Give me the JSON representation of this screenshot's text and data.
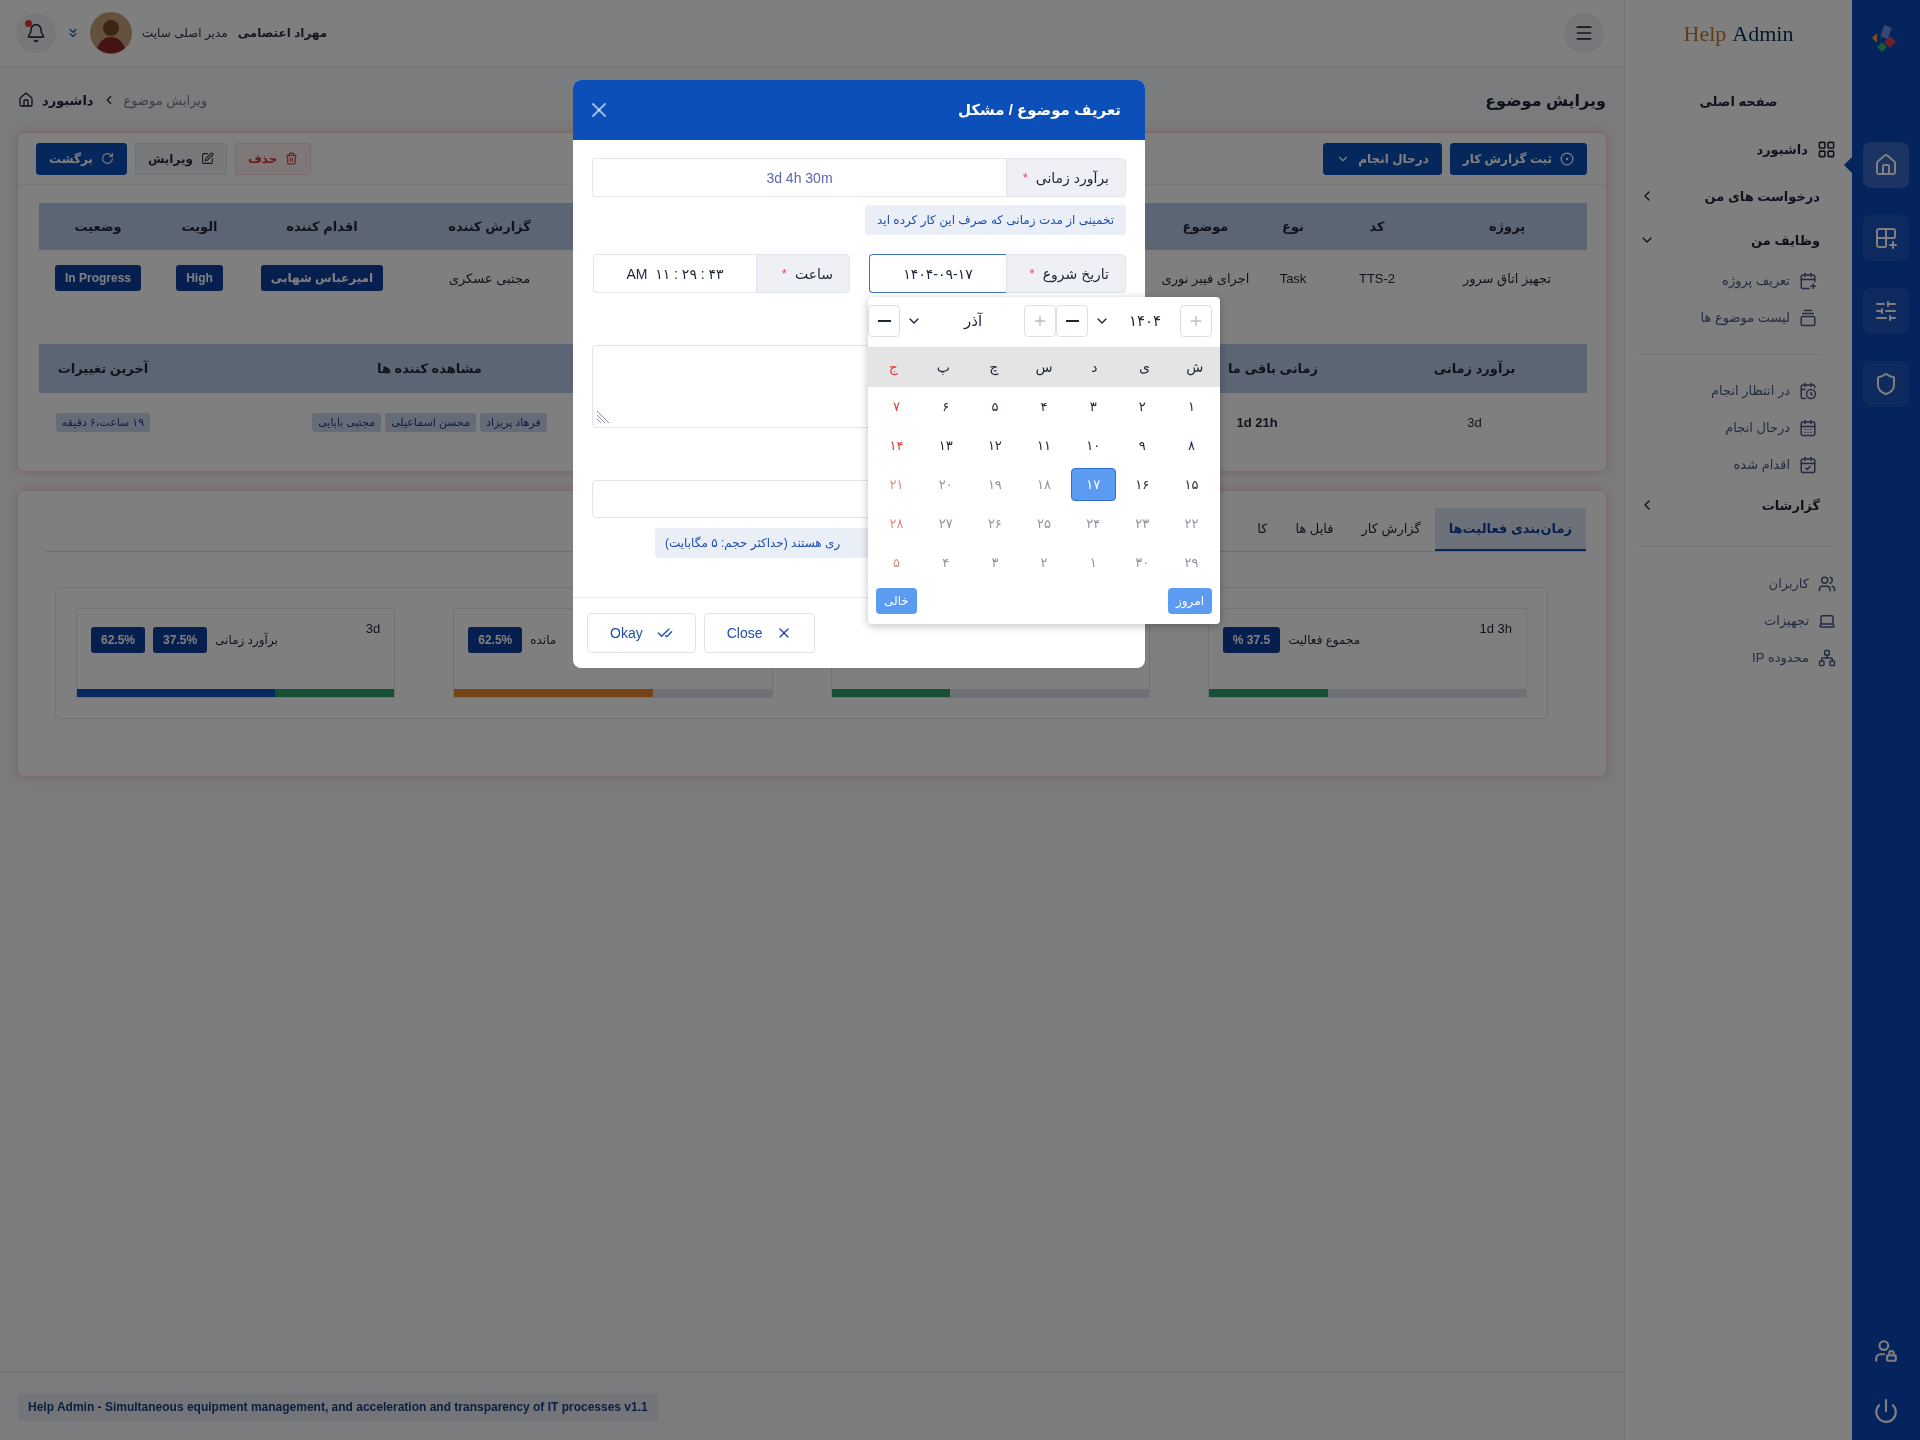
{
  "topbar": {
    "has_notification": true,
    "user_role": "مدیر اصلی سایت",
    "user_name": "مهراد اعتصامی"
  },
  "breadcrumb": [
    "ویرایش موضوع",
    "داشبورد"
  ],
  "page_title": "ویرایش موضوع",
  "actions": [
    {
      "label": "ثبت گزارش کار",
      "kind": "primary"
    },
    {
      "label": "درحال انجام",
      "kind": "dropdown"
    }
  ],
  "secondary_actions": [
    {
      "label": "حذف",
      "kind": "danger"
    },
    {
      "label": "ویرایش",
      "kind": "light"
    },
    {
      "label": "برگشت",
      "kind": "primary"
    }
  ],
  "issue_table": {
    "columns": [
      "پروژه",
      "کد",
      "نوع",
      "موضوع",
      "گزارش کننده",
      "اقدام کننده",
      "الویت",
      "وضعیت"
    ],
    "row": [
      {
        "kind": "text",
        "text": "تجهیز اتاق سرور"
      },
      {
        "kind": "text",
        "text": "TTS-2"
      },
      {
        "kind": "text",
        "text": "Task"
      },
      {
        "kind": "text",
        "text": "اجرای فیبر نوری"
      },
      {
        "kind": "text",
        "text": "مجتبی عسکری"
      },
      {
        "kind": "badge",
        "text": "امیرعباس شهابی"
      },
      {
        "kind": "badge",
        "text": "High"
      },
      {
        "kind": "badge",
        "text": "In Progress"
      }
    ]
  },
  "time_table": {
    "columns": [
      "برآورد زمانی",
      "زمانی باقی ما",
      "مشاهده کننده ها",
      "آخرین تغییرات"
    ],
    "row": [
      {
        "kind": "text",
        "text": "3d"
      },
      {
        "kind": "strong",
        "text": "1d 21h"
      },
      {
        "kind": "tags",
        "tags": [
          "فرهاد پریزاد",
          "محسن اسماعیلی",
          "مجتبی بابایی"
        ]
      },
      {
        "kind": "tags",
        "tags": [
          "۱۹ ساعت،۶ دقیقه"
        ]
      }
    ]
  },
  "tabs": [
    {
      "label": "زمان‌بندی فعالیت‌ها",
      "selected": true
    },
    {
      "label": "گزارش کار",
      "selected": false
    },
    {
      "label": "فایل ها",
      "selected": false
    },
    {
      "label": "کا",
      "selected": false
    }
  ],
  "stats": [
    {
      "value": "1d 3h",
      "label": "مجموع فعالیت",
      "badges": [
        "37.5 %"
      ],
      "segments": [
        {
          "level": 0.375,
          "color": "#174f35"
        }
      ]
    },
    {
      "segments": [
        {
          "level": 0.375,
          "color": "#174f35"
        }
      ]
    },
    {
      "label": "مانده",
      "badges": [
        "62.5%"
      ],
      "segments": [
        {
          "level": 0.625,
          "color": "#744416"
        }
      ]
    },
    {
      "value": "3d",
      "label": "برآورد زمانی",
      "badges": [
        "37.5%",
        "62.5%"
      ],
      "segments": [
        {
          "level": 0.625,
          "color": "#0a2860"
        },
        {
          "level": 0.375,
          "color": "#174f35"
        }
      ]
    }
  ],
  "footer": "Help Admin - Simultaneous equipment management, and acceleration and transparency of IT processes v1.1",
  "sidebar": {
    "logo": {
      "first": "Help",
      "second": "Admin"
    },
    "sections": [
      [
        {
          "kind": "heading",
          "label": "صفحه اصلی"
        },
        {
          "kind": "main",
          "label": "داشبورد"
        },
        {
          "kind": "group",
          "label": "درخواست های من",
          "expanded": false
        },
        {
          "kind": "group",
          "label": "وظایف من",
          "expanded": true,
          "children": [
            {
              "kind": "link",
              "label": "تعریف پروژه"
            },
            {
              "kind": "link",
              "label": "لیست موضوع ها"
            },
            {
              "kind": "divider"
            },
            {
              "kind": "link",
              "label": "در انتظار انجام"
            },
            {
              "kind": "link",
              "label": "درحال انجام"
            },
            {
              "kind": "link",
              "label": "اقدام شده"
            }
          ]
        },
        {
          "kind": "group",
          "label": "گزارشات",
          "expanded": false
        }
      ],
      [
        {
          "kind": "link",
          "label": "کاربران"
        },
        {
          "kind": "link",
          "label": "تجهیزات"
        },
        {
          "kind": "link",
          "label": "محدوده IP"
        }
      ]
    ]
  },
  "rail": {
    "items": [
      {
        "selected": true
      },
      {
        "selected": false
      },
      {
        "selected": false
      },
      {
        "selected": false
      }
    ]
  },
  "modal": {
    "title": "تعریف موضوع / مشکل",
    "estimate": {
      "label": "برآورد زمانی",
      "mark": "*",
      "value": "3d 4h 30m",
      "hint": "تخمینی از مدت زمانی که صرف این کار کرده اید"
    },
    "start_date": {
      "label": "تاریخ شروع",
      "mark": "*",
      "value": "۱۴۰۴-۰۹-۱۷",
      "focused": true
    },
    "time": {
      "label": "ساعت",
      "mark": "*",
      "value": "AM  ۱۱ : ۲۹ : ۴۳"
    },
    "upload_hint": "ری هستند (حداکثر حجم: ۵ مگابایت)",
    "buttons": [
      {
        "label": "Close",
        "kind": "close"
      },
      {
        "label": "Okay",
        "kind": "ok"
      }
    ]
  },
  "calendar": {
    "year": {
      "value": "۱۴۰۴",
      "increment_disabled": true
    },
    "month": {
      "value": "آذر",
      "increment_disabled": true
    },
    "weekdays": [
      {
        "label": "ش",
        "holiday": false
      },
      {
        "label": "ی",
        "holiday": false
      },
      {
        "label": "د",
        "holiday": false
      },
      {
        "label": "س",
        "holiday": false
      },
      {
        "label": "چ",
        "holiday": false
      },
      {
        "label": "پ",
        "holiday": false
      },
      {
        "label": "ج",
        "holiday": true
      }
    ],
    "days": [
      {
        "label": "۱",
        "selected": false,
        "disabled": false,
        "holiday": false
      },
      {
        "label": "۲",
        "selected": false,
        "disabled": false,
        "holiday": false
      },
      {
        "label": "۳",
        "selected": false,
        "disabled": false,
        "holiday": false
      },
      {
        "label": "۴",
        "selected": false,
        "disabled": false,
        "holiday": false
      },
      {
        "label": "۵",
        "selected": false,
        "disabled": false,
        "holiday": false
      },
      {
        "label": "۶",
        "selected": false,
        "disabled": false,
        "holiday": false
      },
      {
        "label": "۷",
        "selected": false,
        "disabled": false,
        "holiday": true
      },
      {
        "label": "۸",
        "selected": false,
        "disabled": false,
        "holiday": false
      },
      {
        "label": "۹",
        "selected": false,
        "disabled": false,
        "holiday": false
      },
      {
        "label": "۱۰",
        "selected": false,
        "disabled": false,
        "holiday": false
      },
      {
        "label": "۱۱",
        "selected": false,
        "disabled": false,
        "holiday": false
      },
      {
        "label": "۱۲",
        "selected": false,
        "disabled": false,
        "holiday": false
      },
      {
        "label": "۱۳",
        "selected": false,
        "disabled": false,
        "holiday": false
      },
      {
        "label": "۱۴",
        "selected": false,
        "disabled": false,
        "holiday": true
      },
      {
        "label": "۱۵",
        "selected": false,
        "disabled": false,
        "holiday": false
      },
      {
        "label": "۱۶",
        "selected": false,
        "disabled": false,
        "holiday": false
      },
      {
        "label": "۱۷",
        "selected": true,
        "disabled": false,
        "holiday": false
      },
      {
        "label": "۱۸",
        "selected": false,
        "disabled": true,
        "holiday": false
      },
      {
        "label": "۱۹",
        "selected": false,
        "disabled": true,
        "holiday": false
      },
      {
        "label": "۲۰",
        "selected": false,
        "disabled": true,
        "holiday": false
      },
      {
        "label": "۲۱",
        "selected": false,
        "disabled": true,
        "holiday": true
      },
      {
        "label": "۲۲",
        "selected": false,
        "disabled": true,
        "holiday": false
      },
      {
        "label": "۲۳",
        "selected": false,
        "disabled": true,
        "holiday": false
      },
      {
        "label": "۲۴",
        "selected": false,
        "disabled": true,
        "holiday": false
      },
      {
        "label": "۲۵",
        "selected": false,
        "disabled": true,
        "holiday": false
      },
      {
        "label": "۲۶",
        "selected": false,
        "disabled": true,
        "holiday": false
      },
      {
        "label": "۲۷",
        "selected": false,
        "disabled": true,
        "holiday": false
      },
      {
        "label": "۲۸",
        "selected": false,
        "disabled": true,
        "holiday": true
      },
      {
        "label": "۲۹",
        "selected": false,
        "disabled": true,
        "holiday": false
      },
      {
        "label": "۳۰",
        "selected": false,
        "disabled": true,
        "holiday": false
      },
      {
        "label": "۱",
        "selected": false,
        "disabled": true,
        "holiday": false
      },
      {
        "label": "۲",
        "selected": false,
        "disabled": true,
        "holiday": false
      },
      {
        "label": "۳",
        "selected": false,
        "disabled": true,
        "holiday": false
      },
      {
        "label": "۴",
        "selected": false,
        "disabled": true,
        "holiday": false
      },
      {
        "label": "۵",
        "selected": false,
        "disabled": true,
        "holiday": true
      }
    ],
    "buttons": [
      {
        "label": "امروز"
      },
      {
        "label": "خالی"
      }
    ]
  }
}
